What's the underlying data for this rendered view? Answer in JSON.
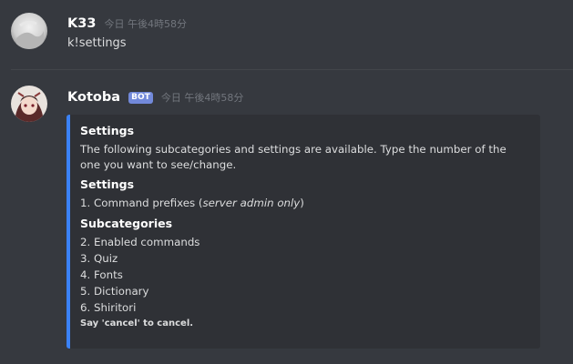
{
  "messages": [
    {
      "username": "K33",
      "timestamp": "今日 午後4時58分",
      "content": "k!settings"
    },
    {
      "username": "Kotoba",
      "bot_tag": "BOT",
      "timestamp": "今日 午後4時58分",
      "embed": {
        "accent_color": "#3b82f6",
        "title": "Settings",
        "description": "The following subcategories and settings are available. Type the number of the one you want to see/change.",
        "fields": [
          {
            "name": "Settings",
            "items": [
              {
                "prefix": "1. Command prefixes (",
                "italic": "server admin only",
                "suffix": ")"
              }
            ]
          },
          {
            "name": "Subcategories",
            "items": [
              "2. Enabled commands",
              "3. Quiz",
              "4. Fonts",
              "5. Dictionary",
              "6. Shiritori"
            ]
          }
        ],
        "footer": "Say 'cancel' to cancel."
      }
    }
  ]
}
